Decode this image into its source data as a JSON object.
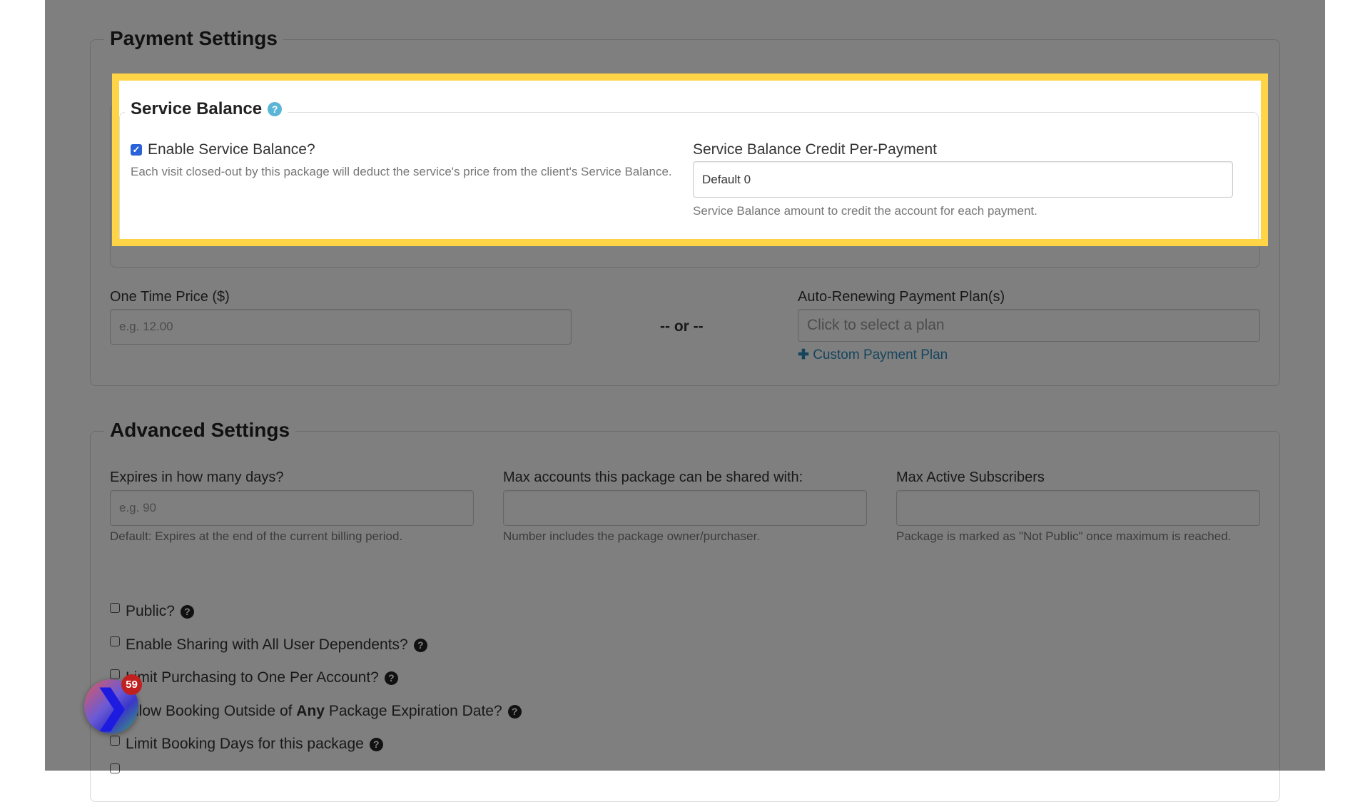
{
  "payment_settings": {
    "title": "Payment Settings",
    "service_balance": {
      "title": "Service Balance",
      "help_icon": "question-circle-icon",
      "enable_checkbox": {
        "label": "Enable Service Balance?",
        "checked": true
      },
      "enable_help": "Each visit closed-out by this package will deduct the service's price from the client's Service Balance.",
      "credit_label": "Service Balance Credit Per-Payment",
      "credit_value": "Default 0",
      "credit_help": "Service Balance amount to credit the account for each payment."
    },
    "one_time_price": {
      "label": "One Time Price ($)",
      "placeholder": "e.g. 12.00"
    },
    "or_separator": "-- or --",
    "payment_plans": {
      "label": "Auto-Renewing Payment Plan(s)",
      "placeholder": "Click to select a plan",
      "custom_link": "Custom Payment Plan",
      "custom_link_icon": "plus-icon"
    }
  },
  "advanced_settings": {
    "title": "Advanced Settings",
    "fields": [
      {
        "label": "Expires in how many days?",
        "placeholder": "e.g. 90",
        "help": "Default: Expires at the end of the current billing period."
      },
      {
        "label": "Max accounts this package can be shared with:",
        "placeholder": "",
        "help": "Number includes the package owner/purchaser."
      },
      {
        "label": "Max Active Subscribers",
        "placeholder": "",
        "help": "Package is marked as \"Not Public\" once maximum is reached."
      }
    ],
    "checkboxes": [
      {
        "label": "Public?",
        "checked": false
      },
      {
        "label": "Enable Sharing with All User Dependents?",
        "checked": false
      },
      {
        "label": "Limit Purchasing to One Per Account?",
        "checked": false
      },
      {
        "label_pre": "Allow Booking Outside of ",
        "label_bold": "Any",
        "label_post": " Package Expiration Date?",
        "checked": false
      },
      {
        "label": "Limit Booking Days for this package",
        "checked": false
      }
    ]
  },
  "widget": {
    "badge_count": "59",
    "icon": "chevron-logo-icon"
  },
  "colors": {
    "highlight": "#ffd447",
    "checkbox_checked": "#2962d9",
    "link": "#2a8bb8",
    "help_icon": "#5bb5d6",
    "badge": "#c0201f"
  }
}
